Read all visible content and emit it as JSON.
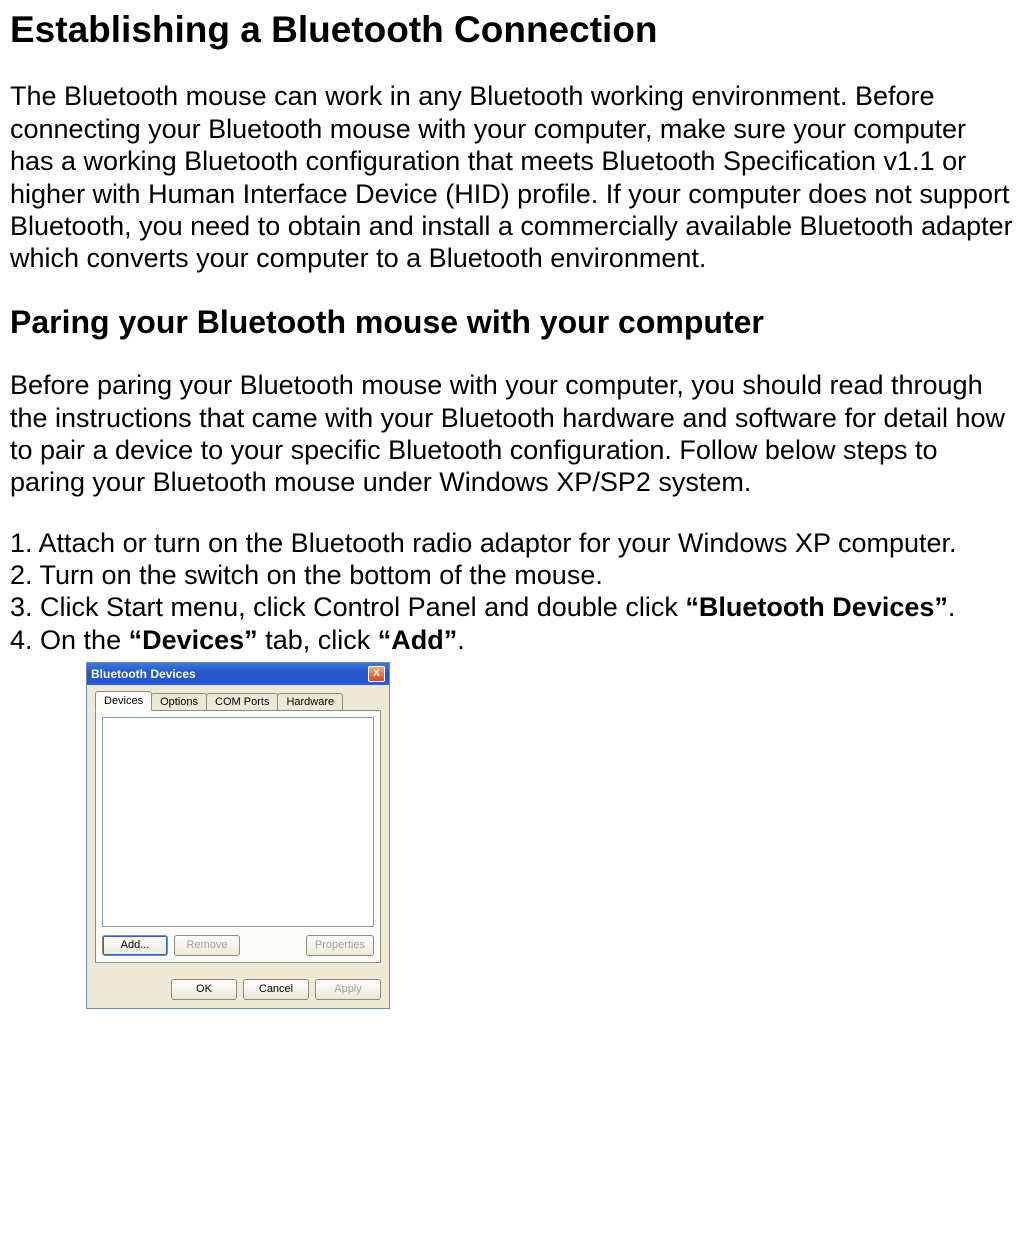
{
  "headings": {
    "h1": "Establishing a Bluetooth Connection",
    "h2": "Paring your Bluetooth mouse with your computer"
  },
  "paragraphs": {
    "intro": "The Bluetooth mouse can work in any Bluetooth working environment. Before connecting your Bluetooth mouse with your computer, make sure your computer has a working Bluetooth configuration that meets Bluetooth Specification v1.1 or higher with Human Interface Device (HID) profile. If your computer does not support Bluetooth, you need to obtain and install a commercially available Bluetooth adapter which converts your computer to a Bluetooth environment.",
    "pairing_intro": "Before paring your Bluetooth mouse with your computer, you should read through the instructions that came with your Bluetooth hardware and software for detail how to pair a device to your specific Bluetooth configuration. Follow below steps to paring your Bluetooth mouse under Windows XP/SP2 system."
  },
  "steps": {
    "s1_num": "1. ",
    "s1": "Attach or turn on the Bluetooth radio adaptor for your Windows XP computer.",
    "s2_num": "2. ",
    "s2": "Turn on the switch on the bottom of the mouse.",
    "s3_num": "3. ",
    "s3a": "Click Start menu, click Control Panel and double click ",
    "s3b": "“Bluetooth Devices”",
    "s3c": ".",
    "s4_num": "4. ",
    "s4a": "On the ",
    "s4b": "“Devices”",
    "s4c": " tab, click ",
    "s4d": "“Add”",
    "s4e": "."
  },
  "dialog": {
    "title": "Bluetooth Devices",
    "tabs": {
      "devices": "Devices",
      "options": "Options",
      "com_ports": "COM Ports",
      "hardware": "Hardware"
    },
    "buttons": {
      "add": "Add...",
      "remove": "Remove",
      "properties": "Properties",
      "ok": "OK",
      "cancel": "Cancel",
      "apply": "Apply",
      "close": "X"
    }
  }
}
